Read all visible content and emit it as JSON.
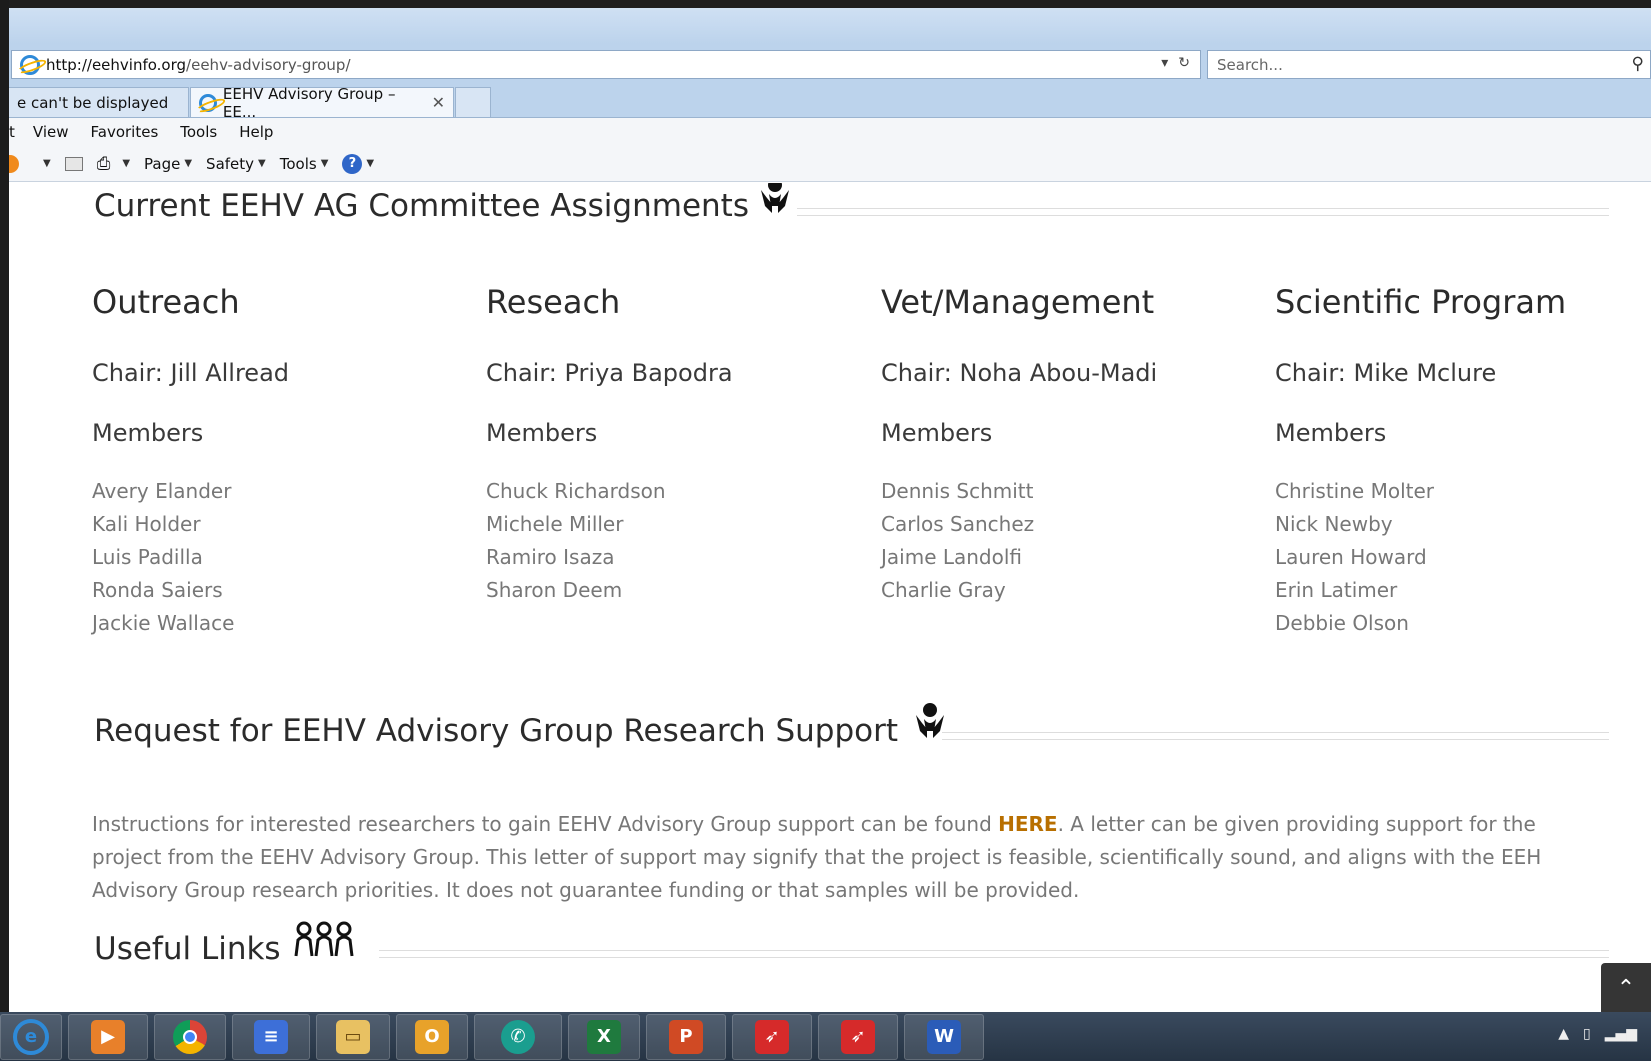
{
  "browser": {
    "url_host": "http://eehvinfo.org",
    "url_path": "/eehv-advisory-group/",
    "search_placeholder": "Search...",
    "tabs": [
      {
        "label": "e can't be displayed"
      },
      {
        "label": "EEHV Advisory Group – EE..."
      }
    ],
    "menu": [
      "t",
      "View",
      "Favorites",
      "Tools",
      "Help"
    ],
    "commands": [
      "Page",
      "Safety",
      "Tools"
    ]
  },
  "assignments": {
    "title": "Current EEHV AG Committee Assignments",
    "columns": [
      {
        "title": "Outreach",
        "chair": "Chair: Jill Allread",
        "members_label": "Members",
        "members": [
          "Avery Elander",
          "Kali Holder",
          "Luis Padilla",
          "Ronda Saiers",
          "Jackie Wallace"
        ]
      },
      {
        "title": "Reseach",
        "chair": "Chair: Priya Bapodra",
        "members_label": "Members",
        "members": [
          "Chuck Richardson",
          "Michele Miller",
          "Ramiro Isaza",
          "Sharon Deem"
        ]
      },
      {
        "title": "Vet/Management",
        "chair": "Chair: Noha Abou-Madi",
        "members_label": "Members",
        "members": [
          "Dennis Schmitt",
          "Carlos Sanchez",
          "Jaime Landolfi",
          "Charlie Gray"
        ]
      },
      {
        "title": "Scientific Program",
        "chair": "Chair: Mike Mclure",
        "members_label": "Members",
        "members": [
          "Christine Molter",
          "Nick Newby",
          "Lauren Howard",
          "Erin Latimer",
          "Debbie Olson"
        ]
      }
    ]
  },
  "support": {
    "title": "Request for EEHV Advisory Group Research Support",
    "text_before": "Instructions for interested researchers to gain EEHV Advisory Group support can be found ",
    "link": "HERE",
    "text_after": ". A letter can be given providing support for the project from the EEHV Advisory Group. This letter of support may signify that the project is feasible, scientifically sound, and aligns with the EEH Advisory Group research priorities. It does not guarantee funding or that samples will be provided."
  },
  "links": {
    "title": "Useful Links"
  },
  "colors": {
    "link": "#b86f00",
    "heading": "#2b2b2b",
    "body": "#777777"
  }
}
